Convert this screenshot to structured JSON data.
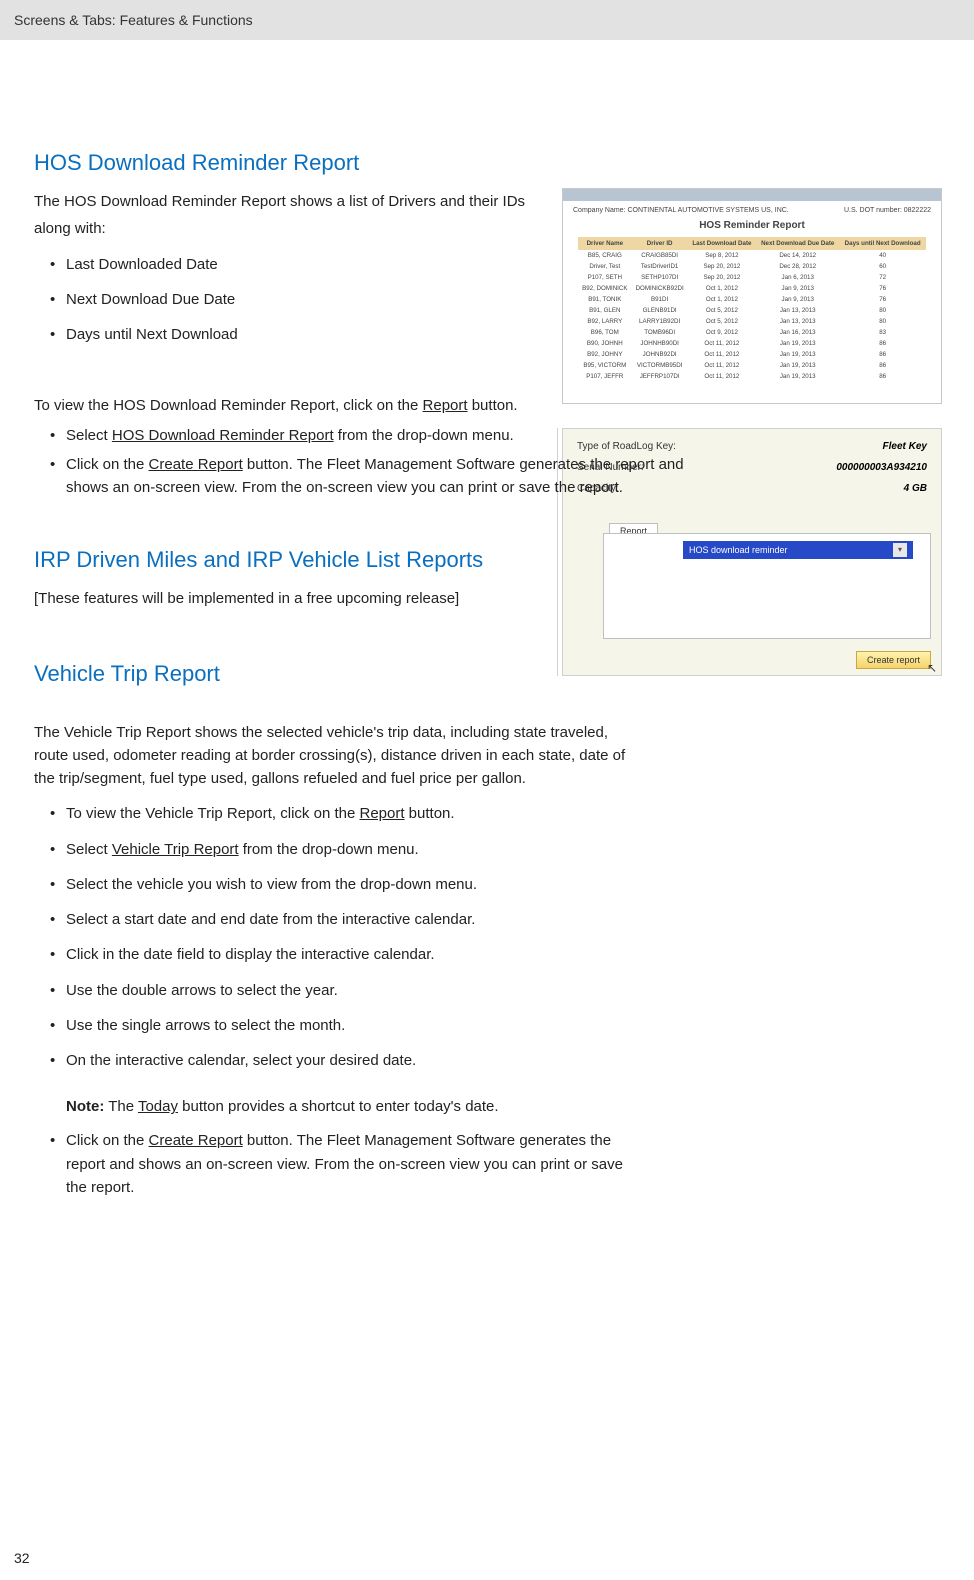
{
  "topbar": "Screens & Tabs: Features & Functions",
  "page_number": "32",
  "s1": {
    "heading": "HOS Download Reminder Report",
    "intro1": "The HOS Download Reminder Report shows a list of Drivers and their IDs",
    "intro2": "along with:",
    "bullets": {
      "b1": "Last Downloaded Date",
      "b2": "Next Download Due Date",
      "b3": "Days until Next Download"
    }
  },
  "s2": {
    "p1_pre": "To view the HOS Download Reminder Report, click on the ",
    "p1_u": "Report",
    "p1_post": " button.",
    "b1_pre": "Select ",
    "b1_u": "HOS Download Reminder Report",
    "b1_post": " from the drop-down menu.",
    "b2_pre": "Click on the ",
    "b2_u": "Create Report",
    "b2_post": " button. The Fleet Management Software generates the report and shows an on-screen view. From the on-screen view you can print or save the report."
  },
  "s3": {
    "heading": "IRP Driven Miles and IRP Vehicle List Reports",
    "body": "[These features will be implemented in a free upcoming release]"
  },
  "s4": {
    "heading": "Vehicle Trip Report",
    "intro": "The Vehicle Trip Report shows the selected vehicle's trip data, including state traveled, route used, odometer reading at border crossing(s), distance driven in each state, date of the trip/segment, fuel type used, gallons refueled and fuel price per gallon.",
    "b1_pre": "To view the Vehicle Trip Report, click on the ",
    "b1_u": "Report",
    "b1_post": " button.",
    "b2_pre": "Select ",
    "b2_u": "Vehicle Trip Report",
    "b2_post": " from the drop-down menu.",
    "b3": "Select the vehicle you wish to view from the drop-down menu.",
    "b4": "Select a start date and end date from the interactive calendar.",
    "b5": "Click in the date field to display the interactive calendar.",
    "b6": "Use the double arrows to select the year.",
    "b7": "Use the single arrows to select the month.",
    "b8": "On the interactive calendar, select your desired date.",
    "note_label": "Note:",
    "note_pre": " The ",
    "note_u": "Today",
    "note_post": " button provides a shortcut to enter today's date.",
    "b9_pre": "Click on the ",
    "b9_u": "Create Report",
    "b9_post": " button. The Fleet Management Software generates the report and shows an on-screen view. From the on-screen view you can print or save the report."
  },
  "shot1": {
    "company": "Company Name: CONTINENTAL AUTOMOTIVE SYSTEMS US, INC.",
    "dot": "U.S. DOT number: 0822222",
    "title": "HOS Reminder Report",
    "headers": {
      "c1": "Driver Name",
      "c2": "Driver ID",
      "c3": "Last Download Date",
      "c4": "Next Download Due Date",
      "c5": "Days until Next Download"
    },
    "rows": [
      {
        "c1": "B85, CRAIG",
        "c2": "CRAIGB85DI",
        "c3": "Sep 8, 2012",
        "c4": "Dec 14, 2012",
        "c5": "40"
      },
      {
        "c1": "Driver, Test",
        "c2": "TestDriverID1",
        "c3": "Sep 20, 2012",
        "c4": "Dec 28, 2012",
        "c5": "60"
      },
      {
        "c1": "P107, SETH",
        "c2": "SETHP107DI",
        "c3": "Sep 20, 2012",
        "c4": "Jan 6, 2013",
        "c5": "72"
      },
      {
        "c1": "B92, DOMINICK",
        "c2": "DOMINICKB92DI",
        "c3": "Oct 1, 2012",
        "c4": "Jan 9, 2013",
        "c5": "76"
      },
      {
        "c1": "B91, TONIK",
        "c2": "B91DI",
        "c3": "Oct 1, 2012",
        "c4": "Jan 9, 2013",
        "c5": "76"
      },
      {
        "c1": "B91, GLEN",
        "c2": "GLENB91DI",
        "c3": "Oct 5, 2012",
        "c4": "Jan 13, 2013",
        "c5": "80"
      },
      {
        "c1": "B92, LARRY",
        "c2": "LARRY1B92DI",
        "c3": "Oct 5, 2012",
        "c4": "Jan 13, 2013",
        "c5": "80"
      },
      {
        "c1": "B96, TOM",
        "c2": "TOMB96DI",
        "c3": "Oct 9, 2012",
        "c4": "Jan 16, 2013",
        "c5": "83"
      },
      {
        "c1": "B90, JOHNH",
        "c2": "JOHNHB90DI",
        "c3": "Oct 11, 2012",
        "c4": "Jan 19, 2013",
        "c5": "86"
      },
      {
        "c1": "B92, JOHNY",
        "c2": "JOHNB92DI",
        "c3": "Oct 11, 2012",
        "c4": "Jan 19, 2013",
        "c5": "86"
      },
      {
        "c1": "B95, VICTORM",
        "c2": "VICTORMB95DI",
        "c3": "Oct 11, 2012",
        "c4": "Jan 19, 2013",
        "c5": "86"
      },
      {
        "c1": "P107, JEFFR",
        "c2": "JEFFRP107DI",
        "c3": "Oct 11, 2012",
        "c4": "Jan 19, 2013",
        "c5": "86"
      }
    ]
  },
  "shot2": {
    "r1_label": "Type of RoadLog Key:",
    "r1_val": "Fleet Key",
    "r2_label": "Serial Number:",
    "r2_val": "000000003A934210",
    "r3_label": "Capacity:",
    "r3_val": "4 GB",
    "tab": "Report",
    "dropdown": "HOS download reminder",
    "button": "Create report"
  }
}
